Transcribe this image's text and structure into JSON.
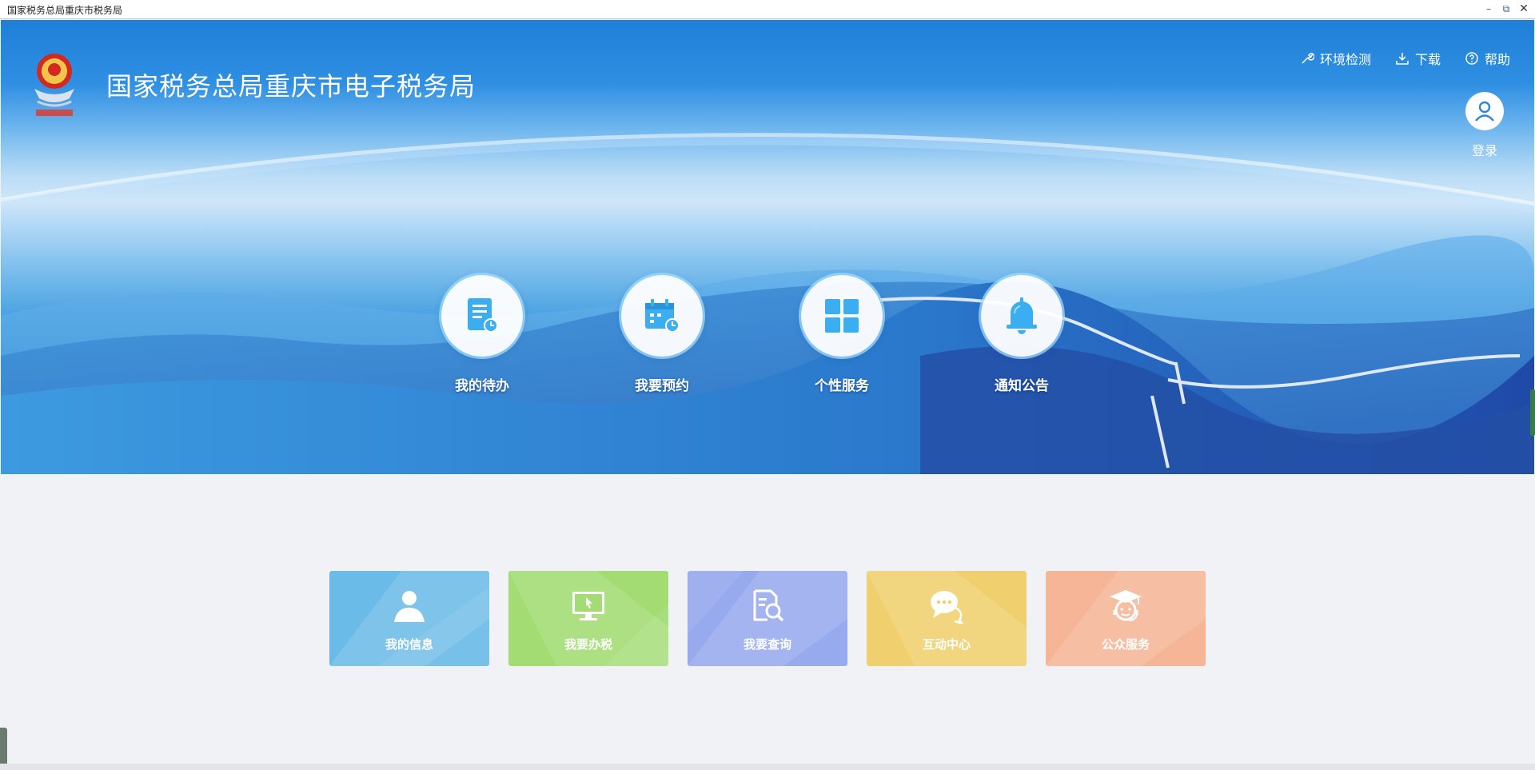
{
  "window": {
    "title": "国家税务总局重庆市税务局"
  },
  "header": {
    "site_title": "国家税务总局重庆市电子税务局",
    "links": [
      {
        "label": "环境检测",
        "icon": "wrench-icon"
      },
      {
        "label": "下载",
        "icon": "download-icon"
      },
      {
        "label": "帮助",
        "icon": "help-icon"
      }
    ],
    "login_label": "登录"
  },
  "quick_items": [
    {
      "label": "我的待办",
      "icon": "todo-document-icon"
    },
    {
      "label": "我要预约",
      "icon": "calendar-clock-icon"
    },
    {
      "label": "个性服务",
      "icon": "grid-icon"
    },
    {
      "label": "通知公告",
      "icon": "bell-icon"
    }
  ],
  "tiles": [
    {
      "label": "我的信息",
      "icon": "user-icon",
      "color": "#6bbbe8"
    },
    {
      "label": "我要办税",
      "icon": "monitor-cursor-icon",
      "color": "#a2dc72"
    },
    {
      "label": "我要查询",
      "icon": "document-search-icon",
      "color": "#98aaee"
    },
    {
      "label": "互动中心",
      "icon": "chat-icon",
      "color": "#f0d06e"
    },
    {
      "label": "公众服务",
      "icon": "graduate-headset-icon",
      "color": "#f5b596"
    }
  ],
  "colors": {
    "banner_blue": "#1f7fd8",
    "icon_blue": "#3aaef0",
    "page_bg": "#f0f2f5"
  }
}
